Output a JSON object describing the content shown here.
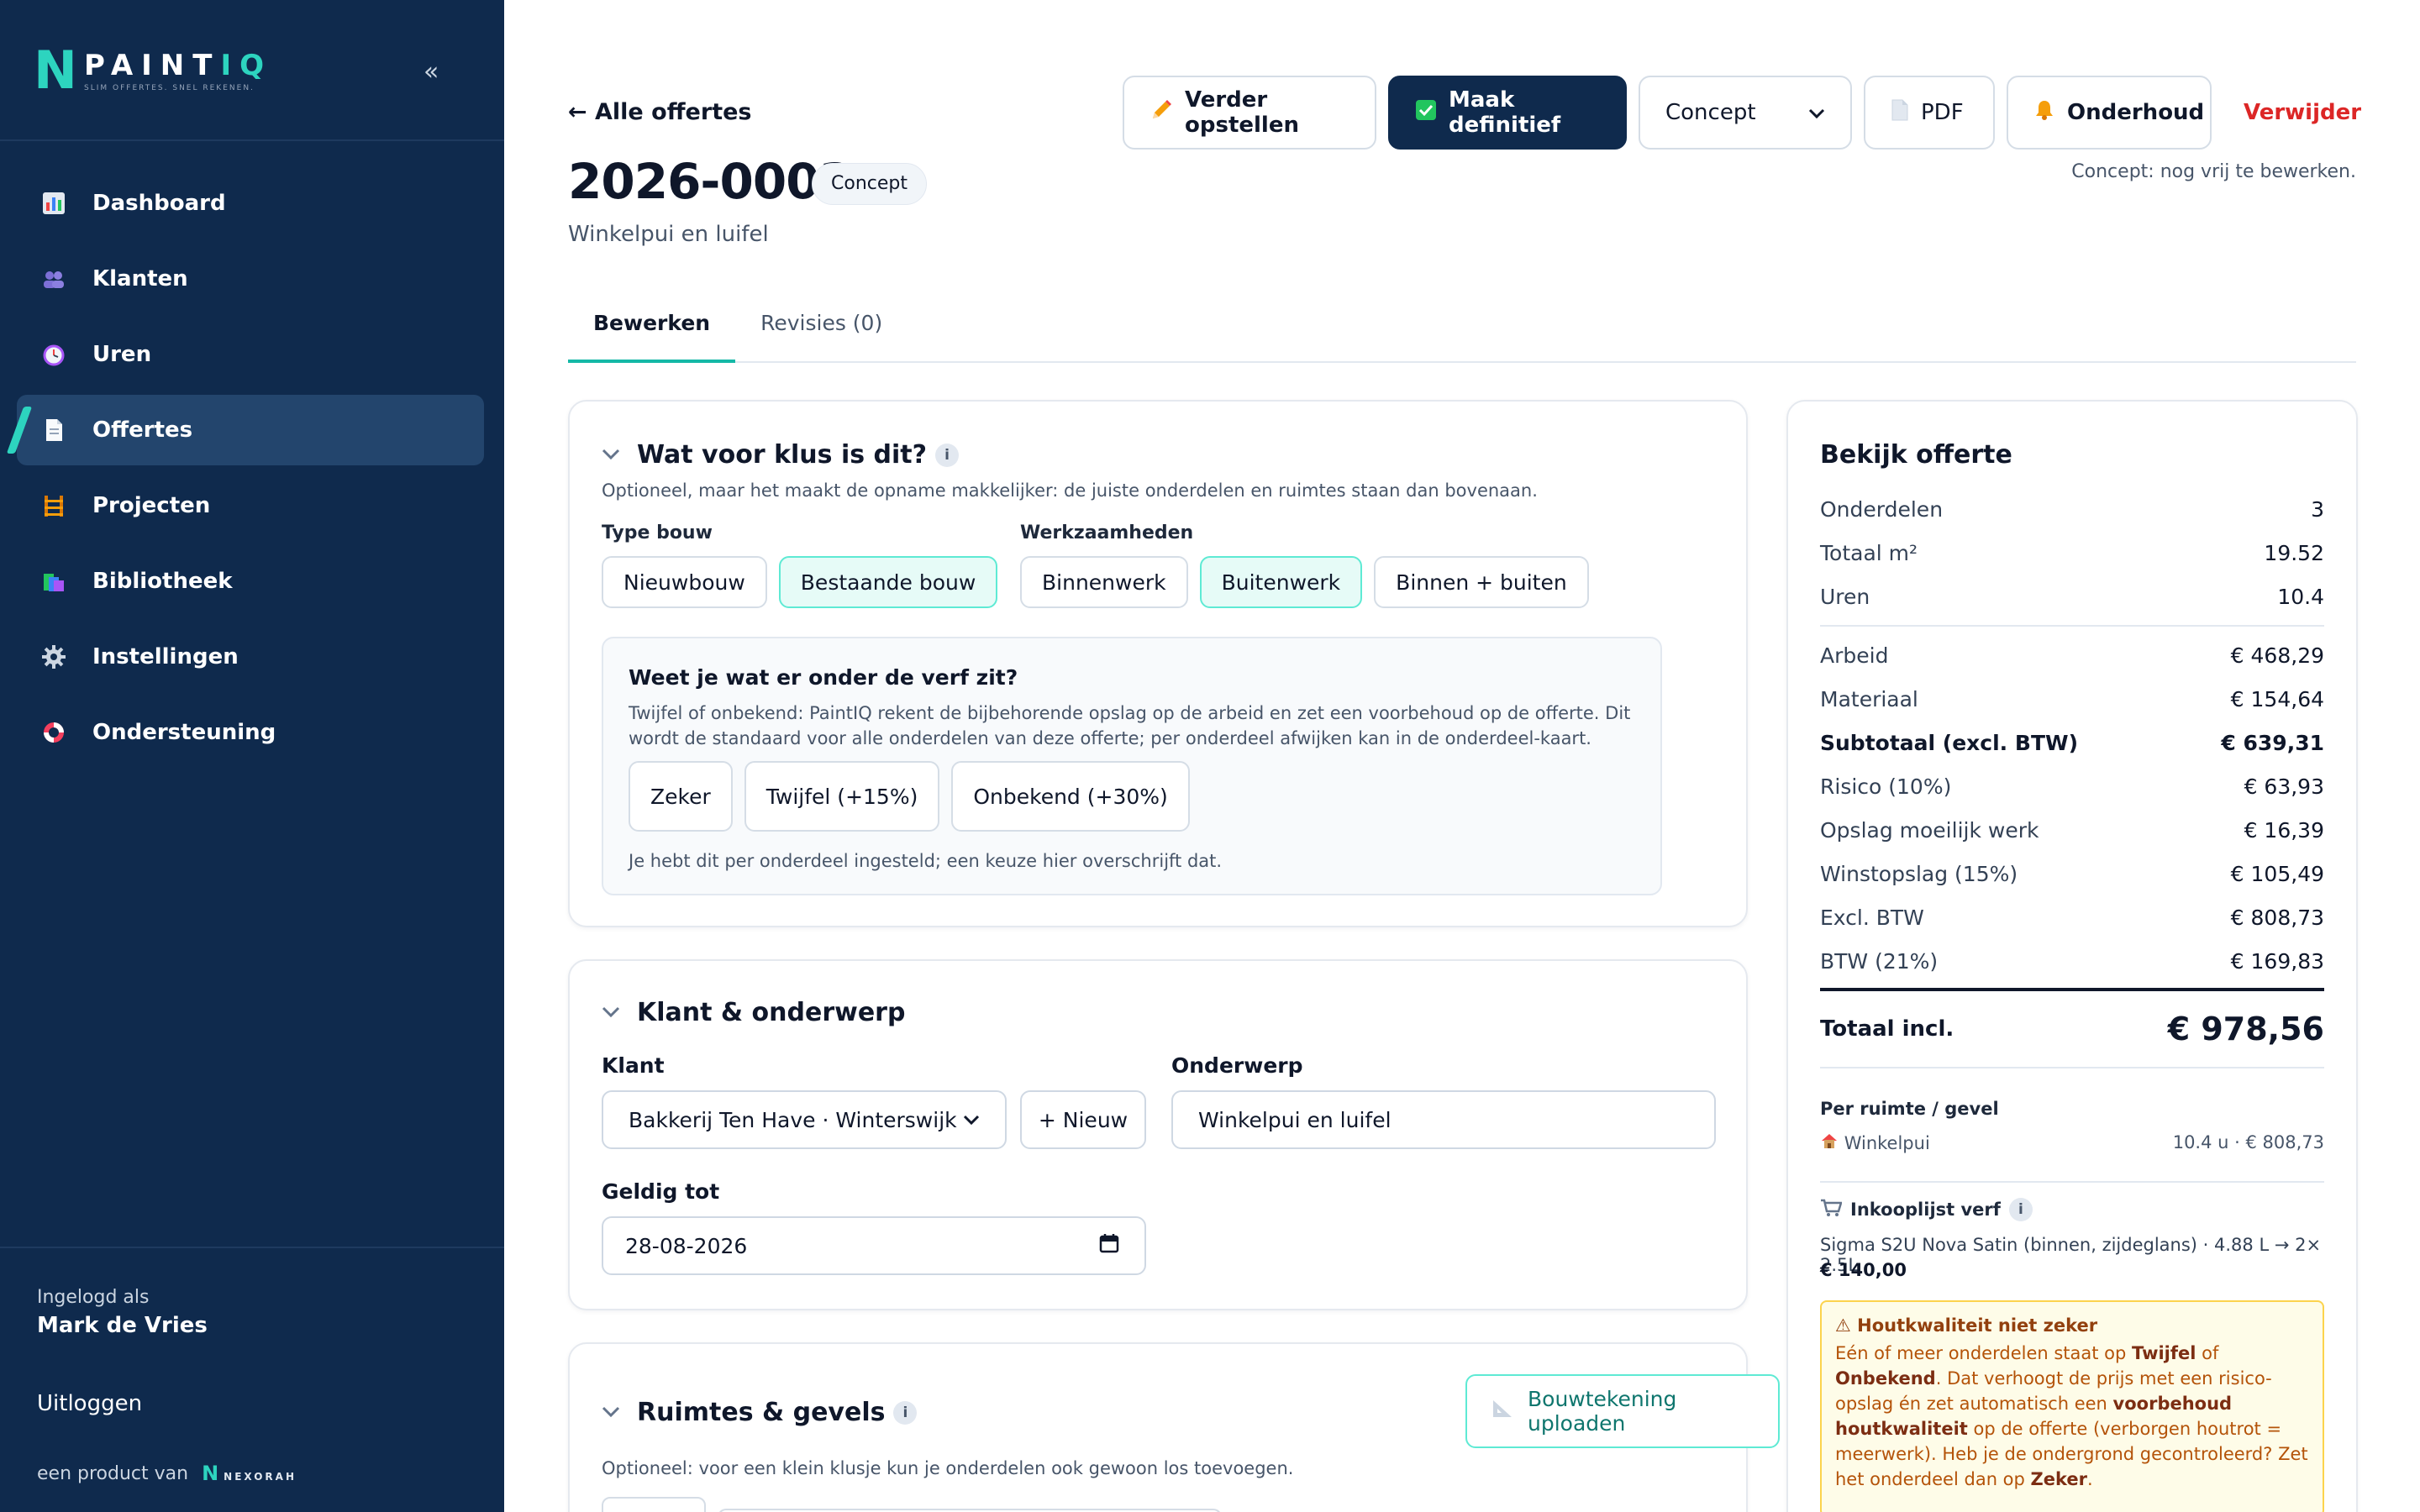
{
  "brand": {
    "name_main": "PAINT",
    "name_accent": "IQ",
    "tagline": "SLIM OFFERTES. SNEL REKENEN."
  },
  "sidebar": {
    "collapse_glyph": "«",
    "items": [
      {
        "label": "Dashboard",
        "icon": "chart-icon"
      },
      {
        "label": "Klanten",
        "icon": "users-icon"
      },
      {
        "label": "Uren",
        "icon": "clock-icon"
      },
      {
        "label": "Offertes",
        "icon": "document-icon"
      },
      {
        "label": "Projecten",
        "icon": "construction-icon"
      },
      {
        "label": "Bibliotheek",
        "icon": "books-icon"
      },
      {
        "label": "Instellingen",
        "icon": "gear-icon"
      },
      {
        "label": "Ondersteuning",
        "icon": "lifebuoy-icon"
      }
    ],
    "active_index": 3,
    "logged_in_label": "Ingelogd als",
    "user_name": "Mark de Vries",
    "logout": "Uitloggen",
    "product_by": "een product van",
    "company_mark": "N",
    "company_name": "NEXORAH"
  },
  "header": {
    "back": "← Alle offertes",
    "title": "2026-0003",
    "status": "Concept",
    "subtitle": "Winkelpui en luifel",
    "hint": "Concept: nog vrij te bewerken."
  },
  "toolbar": {
    "continue": "Verder opstellen",
    "finalize": "Maak definitief",
    "status_select": "Concept",
    "pdf": "PDF",
    "maintenance": "Onderhoud",
    "delete": "Verwijder"
  },
  "tabs": [
    {
      "label": "Bewerken"
    },
    {
      "label": "Revisies (0)"
    }
  ],
  "job": {
    "title": "Wat voor klus is dit?",
    "help": "Optioneel, maar het maakt de opname makkelijker: de juiste onderdelen en ruimtes staan dan bovenaan.",
    "type_label": "Type bouw",
    "types": [
      "Nieuwbouw",
      "Bestaande bouw"
    ],
    "work_label": "Werkzaamheden",
    "works": [
      "Binnenwerk",
      "Buitenwerk",
      "Binnen + buiten"
    ],
    "paint_title": "Weet je wat er onder de verf zit?",
    "paint_text": "Twijfel of onbekend: PaintIQ rekent de bijbehorende opslag op de arbeid en zet een voorbehoud op de offerte. Dit wordt de standaard voor alle onderdelen van deze offerte; per onderdeel afwijken kan in de onderdeel-kaart.",
    "paint_options": [
      "Zeker",
      "Twijfel (+15%)",
      "Onbekend (+30%)"
    ],
    "paint_note": "Je hebt dit per onderdeel ingesteld; een keuze hier overschrijft dat."
  },
  "client": {
    "title": "Klant & onderwerp",
    "client_label": "Klant",
    "client_value": "Bakkerij Ten Have · Winterswijk",
    "new_button": "+ Nieuw",
    "subject_label": "Onderwerp",
    "subject_value": "Winkelpui en luifel",
    "valid_label": "Geldig tot",
    "valid_value": "28-08-2026"
  },
  "rooms": {
    "title": "Ruimtes & gevels",
    "upload": "Bouwtekening uploaden",
    "help": "Optioneel: voor een klein klusje kun je onderdelen ook gewoon los toevoegen."
  },
  "summary": {
    "title": "Bekijk offerte",
    "stats": [
      {
        "label": "Onderdelen",
        "value": "3"
      },
      {
        "label": "Totaal m²",
        "value": "19.52"
      },
      {
        "label": "Uren",
        "value": "10.4"
      }
    ],
    "costs": [
      {
        "label": "Arbeid",
        "value": "€ 468,29"
      },
      {
        "label": "Materiaal",
        "value": "€ 154,64"
      },
      {
        "label": "Subtotaal (excl. BTW)",
        "value": "€ 639,31"
      },
      {
        "label": "Risico (10%)",
        "value": "€ 63,93"
      },
      {
        "label": "Opslag moeilijk werk",
        "value": "€ 16,39"
      },
      {
        "label": "Winstopslag (15%)",
        "value": "€ 105,49"
      },
      {
        "label": "Excl. BTW",
        "value": "€ 808,73"
      },
      {
        "label": "BTW (21%)",
        "value": "€ 169,83"
      }
    ],
    "total_label": "Totaal incl.",
    "total_value": "€ 978,56",
    "per_room_label": "Per ruimte / gevel",
    "room_name": "Winkelpui",
    "room_value": "10.4 u · € 808,73",
    "shopping_label": "Inkooplijst verf",
    "shopping_item": "Sigma S2U Nova Satin (binnen, zijdeglans) · 4.88 L → 2× 2.5L",
    "shopping_price": "€ 140,00",
    "warn_title": "⚠ Houtkwaliteit niet zeker",
    "warn_t1": "Eén of meer onderdelen staat op ",
    "warn_b1": "Twijfel",
    "warn_t2": " of ",
    "warn_b2": "Onbekend",
    "warn_t3": ". Dat verhoogt de prijs met een risico-opslag én zet automatisch een ",
    "warn_b3": "voorbehoud houtkwaliteit",
    "warn_t4": " op de offerte (verborgen houtrot = meerwerk). Heb je de ondergrond gecontroleerd? Zet het onderdeel dan op ",
    "warn_b4": "Zeker",
    "warn_t5": "."
  },
  "colors": {
    "sidebar": "#0f2a4d",
    "accent": "#2dd4bf",
    "danger": "#dc2626",
    "warning": "#fcd34d"
  }
}
